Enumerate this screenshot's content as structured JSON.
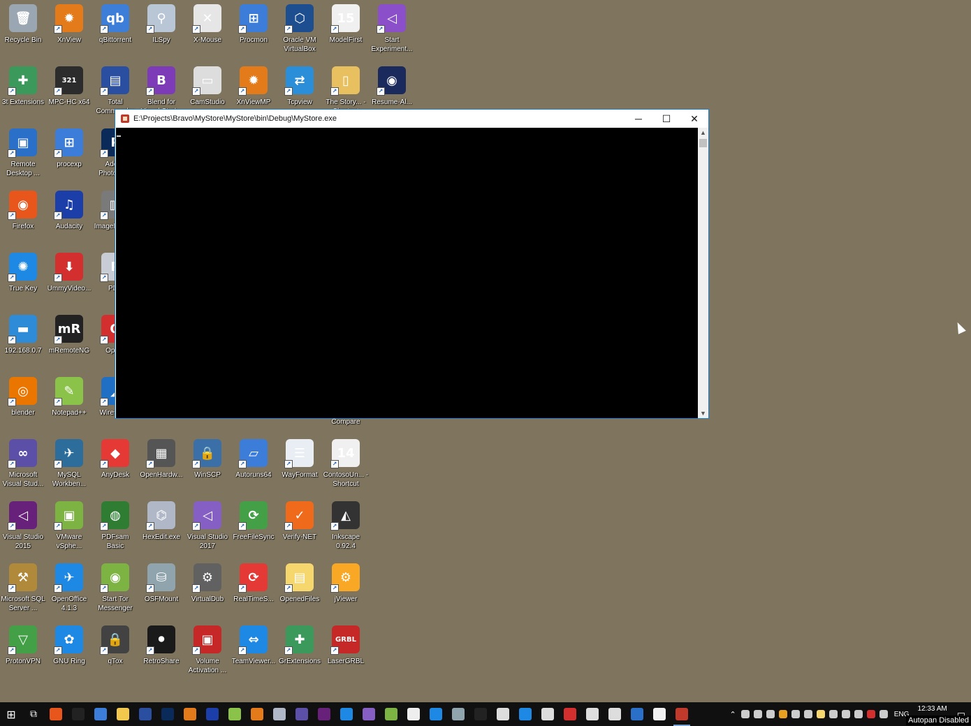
{
  "desktop": {
    "icons": [
      {
        "label": "Recycle Bin",
        "color": "#9aa7b3",
        "glyph": "🗑"
      },
      {
        "label": "XnView",
        "color": "#e37b1b",
        "glyph": "✹"
      },
      {
        "label": "qBittorrent",
        "color": "#3d7fd8",
        "glyph": "qb"
      },
      {
        "label": "ILSpy",
        "color": "#b8c6d6",
        "glyph": "⚲"
      },
      {
        "label": "X-Mouse",
        "color": "#e6e6e6",
        "glyph": "✕"
      },
      {
        "label": "Procmon",
        "color": "#3b7dd8",
        "glyph": "⊞"
      },
      {
        "label": "Oracle VM VirtualBox",
        "color": "#1d4e8f",
        "glyph": "⬡"
      },
      {
        "label": "ModelFirst",
        "color": "#f0f0f0",
        "glyph": "15"
      },
      {
        "label": "Start Experiment...",
        "color": "#8a4fc9",
        "glyph": "◁"
      },
      {
        "label": "3t Extensions",
        "color": "#3b9a5b",
        "glyph": "✚"
      },
      {
        "label": "MPC-HC x64",
        "color": "#2c2c2c",
        "glyph": "321"
      },
      {
        "label": "Total Commander",
        "color": "#2a4fa1",
        "glyph": "▤"
      },
      {
        "label": "Blend for Visual Stud...",
        "color": "#7e3bb8",
        "glyph": "B"
      },
      {
        "label": "CamStudio",
        "color": "#dddddd",
        "glyph": "▭"
      },
      {
        "label": "XnViewMP",
        "color": "#e37b1b",
        "glyph": "✹"
      },
      {
        "label": "Tcpview",
        "color": "#2a8fd8",
        "glyph": "⇄"
      },
      {
        "label": "The Story... - Shortcut",
        "color": "#e8c060",
        "glyph": "▯"
      },
      {
        "label": "Resume-Al...",
        "color": "#1a2a5c",
        "glyph": "◉"
      },
      {
        "label": "Remote Desktop ...",
        "color": "#2a6fc8",
        "glyph": "▣"
      },
      {
        "label": "procexp",
        "color": "#3b7dd8",
        "glyph": "⊞"
      },
      {
        "label": "Adobe Photoshop",
        "color": "#0a2a5a",
        "glyph": "P"
      },
      {
        "label": "Firefox",
        "color": "#e8561b",
        "glyph": "◉"
      },
      {
        "label": "Audacity",
        "color": "#1b3ea8",
        "glyph": "♫"
      },
      {
        "label": "ImageDisplay",
        "color": "#7a7a7a",
        "glyph": "▥"
      },
      {
        "label": "True Key",
        "color": "#1e88e5",
        "glyph": "✺"
      },
      {
        "label": "UmmyVideo...",
        "color": "#d32f2f",
        "glyph": "⬇"
      },
      {
        "label": "PDF",
        "color": "#c8ccd4",
        "glyph": "P"
      },
      {
        "label": "192.168.0.7",
        "color": "#2e8bd8",
        "glyph": "▬"
      },
      {
        "label": "mRemoteNG",
        "color": "#222222",
        "glyph": "mR"
      },
      {
        "label": "Opera",
        "color": "#d32f2f",
        "glyph": "O"
      },
      {
        "label": "blender",
        "color": "#ea7600",
        "glyph": "◎"
      },
      {
        "label": "Notepad++",
        "color": "#8bc34a",
        "glyph": "✎"
      },
      {
        "label": "Wireshark",
        "color": "#1f6fc4",
        "glyph": "◢"
      },
      {
        "label": "Microsoft Visual Stud...",
        "color": "#5c4fa8",
        "glyph": "∞"
      },
      {
        "label": "MySQL Workben...",
        "color": "#2d6d9b",
        "glyph": "✈"
      },
      {
        "label": "AnyDesk",
        "color": "#e53935",
        "glyph": "◆"
      },
      {
        "label": "OpenHardw...",
        "color": "#555555",
        "glyph": "▦"
      },
      {
        "label": "WinSCP",
        "color": "#3a6fa8",
        "glyph": "🔒"
      },
      {
        "label": "Autoruns64",
        "color": "#3b7dd8",
        "glyph": "▱"
      },
      {
        "label": "WayFormat",
        "color": "#e8eef4",
        "glyph": "☰"
      },
      {
        "label": "ContosoUn... - Shortcut",
        "color": "#f0f0f0",
        "glyph": "14"
      },
      {
        "label": "Visual Studio 2015",
        "color": "#68217a",
        "glyph": "◁"
      },
      {
        "label": "VMware vSphe...",
        "color": "#7cb342",
        "glyph": "▣"
      },
      {
        "label": "PDFsam Basic",
        "color": "#2e7d32",
        "glyph": "◍"
      },
      {
        "label": "HexEdit.exe",
        "color": "#b0b8c8",
        "glyph": "⌬"
      },
      {
        "label": "Visual Studio 2017",
        "color": "#865fc5",
        "glyph": "◁"
      },
      {
        "label": "FreeFileSync",
        "color": "#43a047",
        "glyph": "⟳"
      },
      {
        "label": "Verify-NET",
        "color": "#f06a1c",
        "glyph": "✓"
      },
      {
        "label": "Inkscape 0.92.4",
        "color": "#333333",
        "glyph": "◭"
      },
      {
        "label": "Microsoft SQL Server ...",
        "color": "#b08a3a",
        "glyph": "⚒"
      },
      {
        "label": "OpenOffice 4.1.3",
        "color": "#1e88e5",
        "glyph": "✈"
      },
      {
        "label": "Start Tor Messenger",
        "color": "#7cb342",
        "glyph": "◉"
      },
      {
        "label": "OSFMount",
        "color": "#90a4ae",
        "glyph": "⛁"
      },
      {
        "label": "VirtualDub",
        "color": "#616161",
        "glyph": "⚙"
      },
      {
        "label": "RealTimeS...",
        "color": "#e53935",
        "glyph": "⟳"
      },
      {
        "label": "OpenedFiles",
        "color": "#f5d76e",
        "glyph": "▤"
      },
      {
        "label": "jViewer",
        "color": "#f9a825",
        "glyph": "⚙"
      },
      {
        "label": "ProtonVPN",
        "color": "#43a047",
        "glyph": "▽"
      },
      {
        "label": "GNU Ring",
        "color": "#1e88e5",
        "glyph": "✿"
      },
      {
        "label": "qTox",
        "color": "#424242",
        "glyph": "🔒"
      },
      {
        "label": "RetroShare",
        "color": "#1a1a1a",
        "glyph": "⚫"
      },
      {
        "label": "Volume Activation ...",
        "color": "#c62828",
        "glyph": "▣"
      },
      {
        "label": "TeamViewer...",
        "color": "#1e88e5",
        "glyph": "⇔"
      },
      {
        "label": "GrExtensions",
        "color": "#3b9a5b",
        "glyph": "✚"
      },
      {
        "label": "LaserGRBL",
        "color": "#c62828",
        "glyph": "GRBL"
      }
    ],
    "hidden_behind_window_label": "Compare"
  },
  "window": {
    "title": "E:\\Projects\\Bravo\\MyStore\\MyStore\\bin\\Debug\\MyStore.exe",
    "minimize": "─",
    "maximize": "☐",
    "close": "✕"
  },
  "taskbar": {
    "start": "⊞",
    "task_view": "⧉",
    "apps": [
      "#e8561b",
      "#222",
      "#3b7dd8",
      "#f2c94c",
      "#2a4fa1",
      "#0a2a5a",
      "#e37b1b",
      "#1b3ea8",
      "#8bc34a",
      "#e37b1b",
      "#b0b8c8",
      "#5c4fa8",
      "#68217a",
      "#1e88e5",
      "#865fc5",
      "#7cb342",
      "#eee",
      "#1e88e5",
      "#90a4ae",
      "#222",
      "#ddd",
      "#1e88e5",
      "#ddd",
      "#d32f2f",
      "#ddd",
      "#ddd",
      "#2a6fc8",
      "#f0f0f0",
      "#c0392b"
    ],
    "tray_icons": [
      "#ccc",
      "#ccc",
      "#ccc",
      "#e8a020",
      "#ccc",
      "#ccc",
      "#f5d76e",
      "#ccc",
      "#ccc",
      "#ccc",
      "#d32f2f",
      "#ccc"
    ],
    "language": "ENG",
    "time": "12:33 AM",
    "notification": "▭"
  },
  "overlay": {
    "autopan": "Autopan Disabled"
  }
}
